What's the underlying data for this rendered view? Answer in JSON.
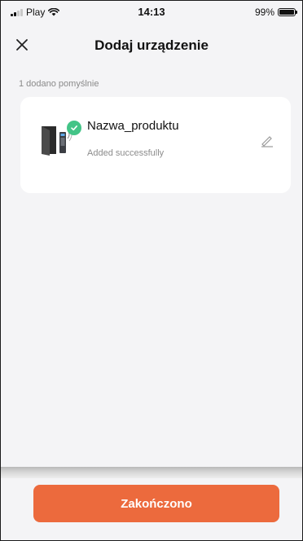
{
  "status_bar": {
    "carrier": "Play",
    "time": "14:13",
    "battery": "99%"
  },
  "header": {
    "title": "Dodaj urządzenie",
    "close_icon": "close-icon"
  },
  "result": {
    "summary": "1 dodano pomyślnie"
  },
  "device": {
    "name": "Nazwa_produktu",
    "status": "Added successfully",
    "icon": "door-lock-icon",
    "badge_icon": "check-icon",
    "edit_icon": "pencil-icon"
  },
  "footer": {
    "finish_label": "Zakończono"
  },
  "colors": {
    "accent": "#ec6a3d",
    "success": "#43c487",
    "background": "#f4f4f6",
    "card": "#ffffff"
  }
}
